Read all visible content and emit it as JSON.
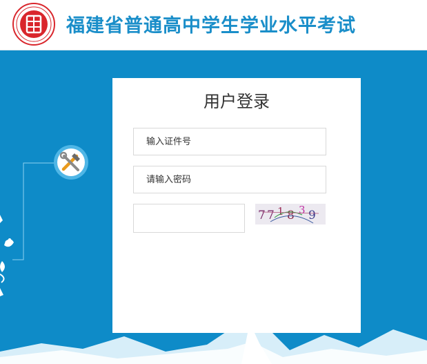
{
  "header": {
    "title": "福建省普通高中学生学业水平考试",
    "logo_icon": "exam-seal-logo-icon"
  },
  "login": {
    "title": "用户登录",
    "id_placeholder": "输入证件号",
    "password_placeholder": "请输入密码",
    "captcha_value": "",
    "captcha_text": "77 1 8 3 9"
  },
  "colors": {
    "header_title": "#1a8ec9",
    "background": "#0e8bc8",
    "logo_red": "#d9262c"
  },
  "decor": {
    "tool_icon": "tools-icon"
  }
}
